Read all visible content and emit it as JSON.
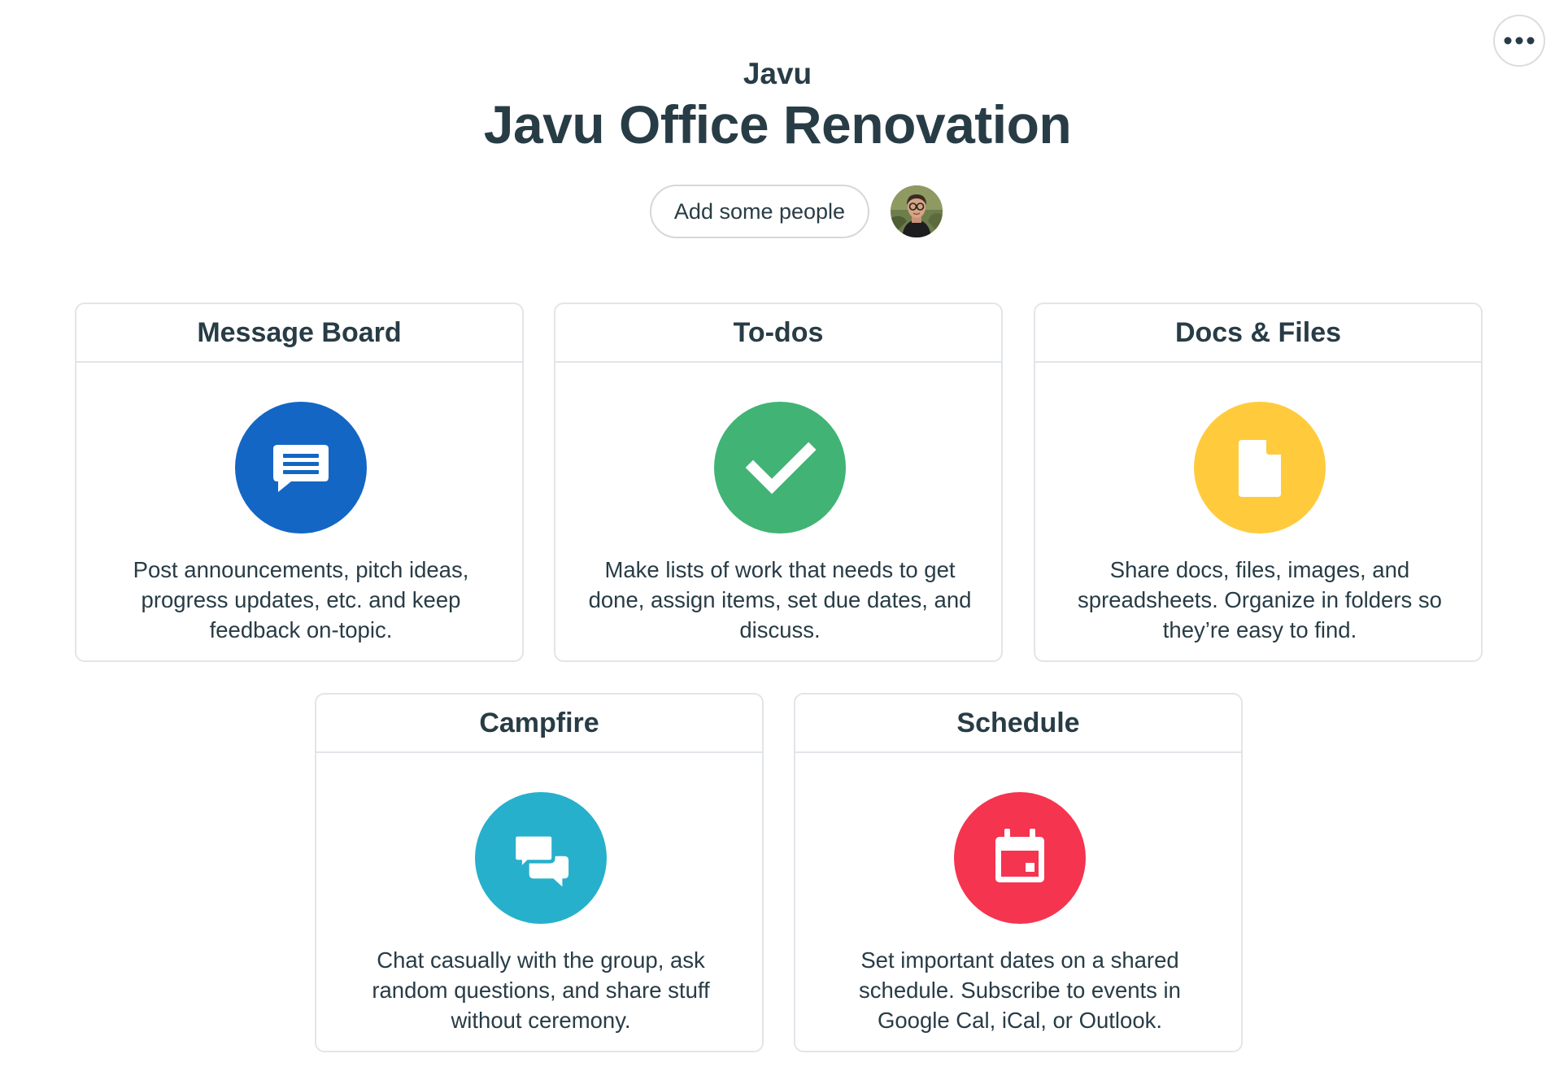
{
  "header": {
    "account_name": "Javu",
    "project_title": "Javu Office Renovation",
    "add_people_label": "Add some people"
  },
  "colors": {
    "message_board": "#1466c4",
    "todos": "#41b375",
    "docs": "#ffcb3d",
    "campfire": "#27b0cc",
    "schedule": "#f5344f",
    "text": "#283c46"
  },
  "tools": {
    "message_board": {
      "title": "Message Board",
      "icon": "message-board-icon",
      "description": "Post announcements, pitch ideas, progress updates, etc. and keep feedback on-topic."
    },
    "todos": {
      "title": "To-dos",
      "icon": "checkmark-icon",
      "description": "Make lists of work that needs to get done, assign items, set due dates, and discuss."
    },
    "docs": {
      "title": "Docs & Files",
      "icon": "document-icon",
      "description": "Share docs, files, images, and spreadsheets. Organize in folders so they’re easy to find."
    },
    "campfire": {
      "title": "Campfire",
      "icon": "chat-bubbles-icon",
      "description": "Chat casually with the group, ask random questions, and share stuff without ceremony."
    },
    "schedule": {
      "title": "Schedule",
      "icon": "calendar-icon",
      "description": "Set important dates on a shared schedule. Subscribe to events in Google Cal, iCal, or Outlook."
    }
  }
}
